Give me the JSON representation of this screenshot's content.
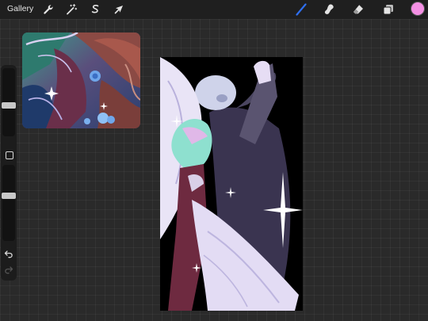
{
  "topbar": {
    "gallery_label": "Gallery",
    "left_tools": [
      {
        "name": "actions",
        "icon": "wrench-icon"
      },
      {
        "name": "adjustments",
        "icon": "magic-wand-icon"
      },
      {
        "name": "selection",
        "icon": "selection-s-icon"
      },
      {
        "name": "transform",
        "icon": "arrow-cursor-icon"
      }
    ],
    "right_tools": [
      {
        "name": "brush",
        "icon": "brush-icon",
        "active": true
      },
      {
        "name": "smudge",
        "icon": "smudge-icon"
      },
      {
        "name": "eraser",
        "icon": "eraser-icon"
      },
      {
        "name": "layers",
        "icon": "layers-icon"
      }
    ],
    "current_color": "#f490e4"
  },
  "sidebar": {
    "brush_size_level": 0.45,
    "opacity_level": 0.6,
    "undo_icon": "undo-icon",
    "redo_icon": "redo-icon",
    "modify_icon": "square-modify-icon"
  },
  "colors": {
    "accent_brush": "#2f6ff0",
    "toolbar_bg": "#1f1f1f",
    "canvas_bg": "#000000"
  }
}
